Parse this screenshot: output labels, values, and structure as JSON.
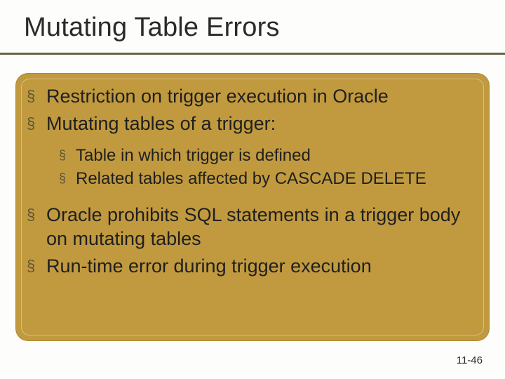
{
  "slide": {
    "title": "Mutating Table Errors",
    "bullets": [
      {
        "text": "Restriction on trigger execution in Oracle"
      },
      {
        "text": "Mutating tables of a trigger:"
      }
    ],
    "sub_bullets": [
      {
        "text": "Table in which trigger is defined"
      },
      {
        "text": "Related tables affected by CASCADE DELETE"
      }
    ],
    "bullets_after": [
      {
        "text": "Oracle prohibits SQL statements in a trigger body on mutating tables"
      },
      {
        "text": "Run-time error during trigger execution"
      }
    ],
    "page_number": "11-46"
  }
}
